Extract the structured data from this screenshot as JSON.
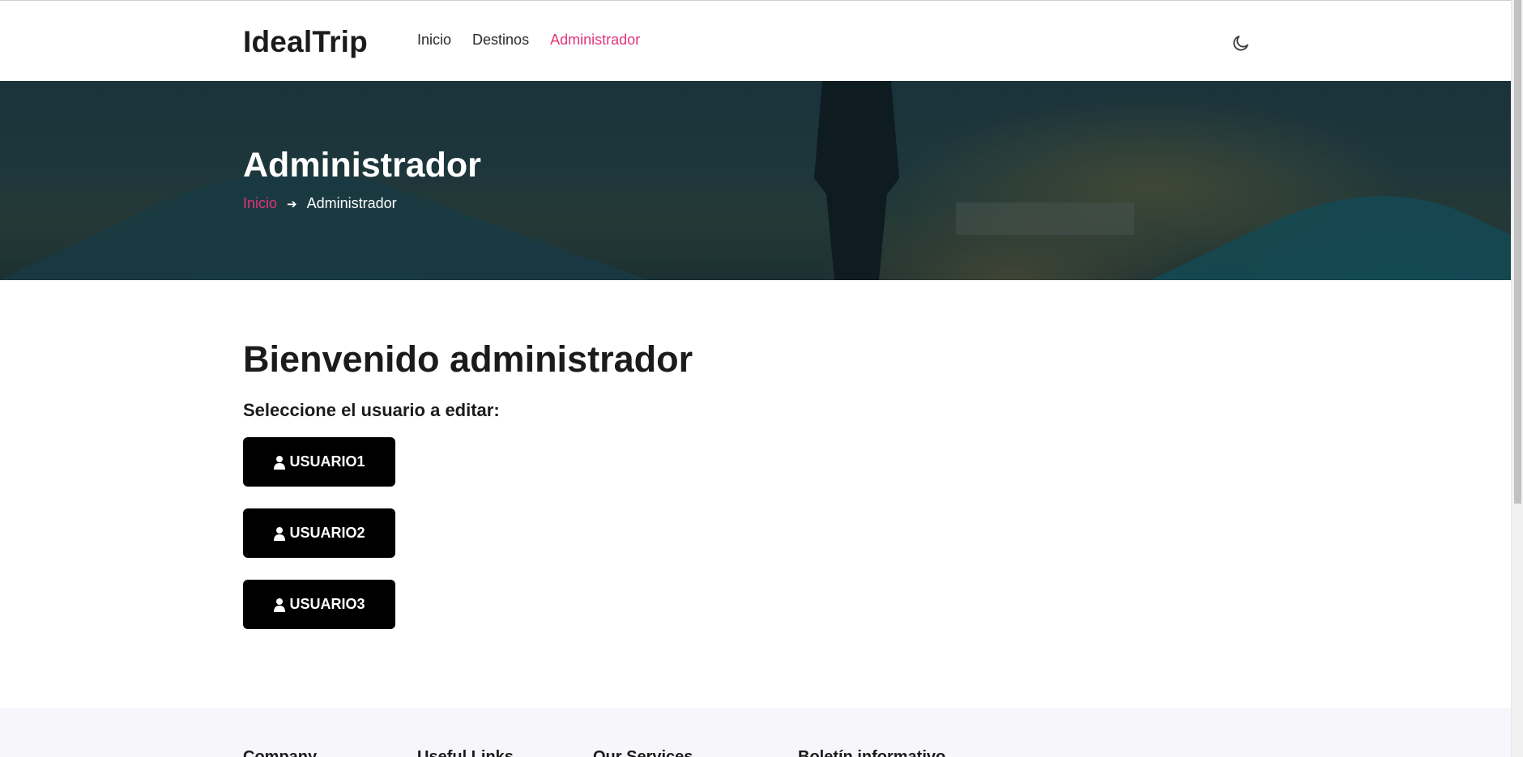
{
  "header": {
    "brand": "IdealTrip",
    "nav": [
      {
        "label": "Inicio",
        "active": false
      },
      {
        "label": "Destinos",
        "active": false
      },
      {
        "label": "Administrador",
        "active": true
      }
    ],
    "theme_icon": "moon-icon"
  },
  "hero": {
    "title": "Administrador",
    "breadcrumb": {
      "link": "Inicio",
      "separator_icon": "arrow-right-icon",
      "current": "Administrador"
    }
  },
  "main": {
    "welcome": "Bienvenido administrador",
    "prompt": "Seleccione el usuario a editar:",
    "users": [
      {
        "label": "USUARIO1",
        "icon": "user-icon"
      },
      {
        "label": "USUARIO2",
        "icon": "user-icon"
      },
      {
        "label": "USUARIO3",
        "icon": "user-icon"
      }
    ]
  },
  "footer": {
    "columns": [
      "Company",
      "Useful Links",
      "Our Services",
      "Boletín informativo"
    ]
  },
  "colors": {
    "accent": "#e0357a",
    "button_bg": "#000000",
    "footer_bg": "#f7f6fb"
  }
}
